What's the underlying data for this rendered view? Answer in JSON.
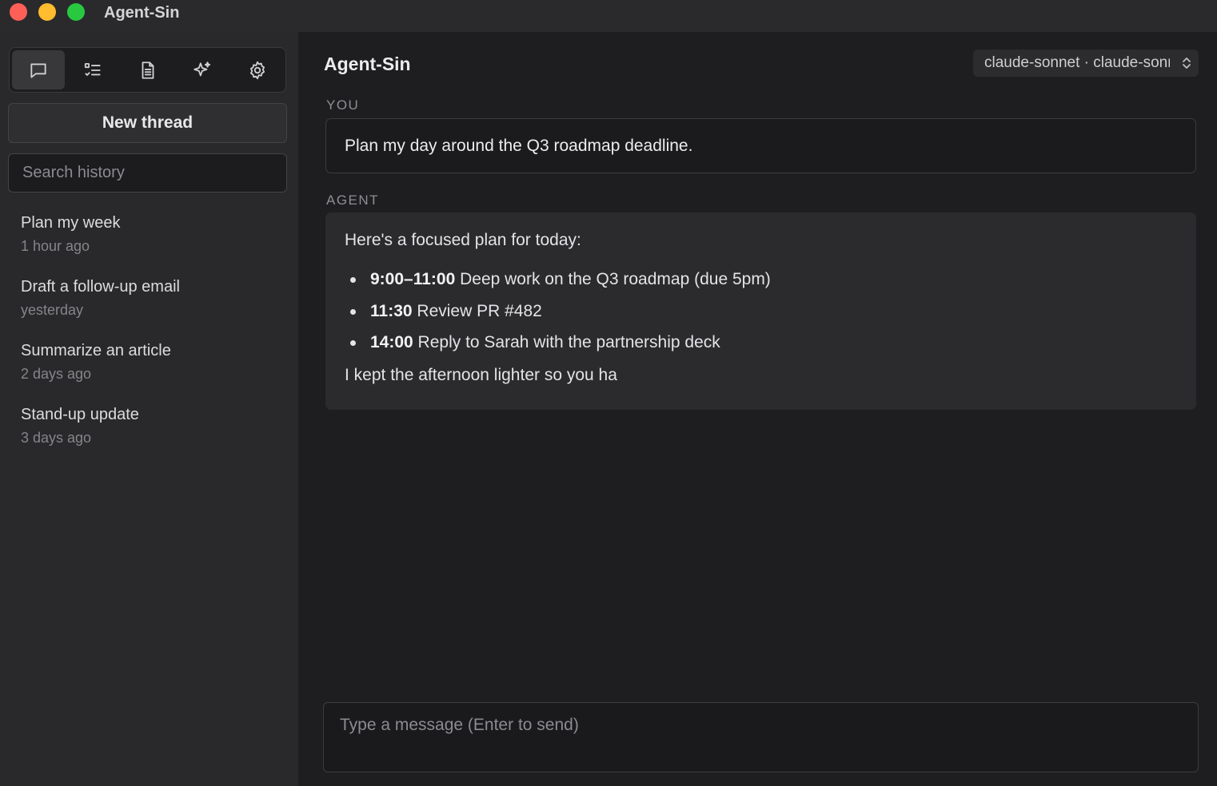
{
  "window": {
    "title": "Agent-Sin"
  },
  "sidebar": {
    "tabs": [
      {
        "name": "chat",
        "icon": "chat-bubble-icon",
        "active": true
      },
      {
        "name": "tasks",
        "icon": "checklist-icon",
        "active": false
      },
      {
        "name": "documents",
        "icon": "document-icon",
        "active": false
      },
      {
        "name": "skills",
        "icon": "sparkles-icon",
        "active": false
      },
      {
        "name": "settings",
        "icon": "gear-icon",
        "active": false
      }
    ],
    "new_thread_label": "New thread",
    "search_placeholder": "Search history",
    "history": [
      {
        "title": "Plan my week",
        "time": "1 hour ago"
      },
      {
        "title": "Draft a follow-up email",
        "time": "yesterday"
      },
      {
        "title": "Summarize an article",
        "time": "2 days ago"
      },
      {
        "title": "Stand-up update",
        "time": "3 days ago"
      }
    ]
  },
  "main": {
    "title": "Agent-Sin",
    "model_select": "claude-sonnet · claude-sonnet",
    "you_label": "YOU",
    "agent_label": "AGENT",
    "user_message": "Plan my day around the Q3 roadmap deadline.",
    "agent_message": {
      "intro": "Here's a focused plan for today:",
      "items": [
        {
          "time": "9:00–11:00",
          "text": " Deep work on the Q3 roadmap (due 5pm)"
        },
        {
          "time": "11:30",
          "text": " Review PR #482"
        },
        {
          "time": "14:00",
          "text": " Reply to Sarah with the partnership deck"
        }
      ],
      "outro": "I kept the afternoon lighter so you ha"
    },
    "composer_placeholder": "Type a message (Enter to send)"
  },
  "colors": {
    "background": "#1e1e20",
    "sidebar": "#29292b",
    "titlebar": "#2a2a2c",
    "agent_bubble": "#2b2b2e",
    "close": "#fe5f57",
    "minimize": "#febc2e",
    "maximize": "#28c840"
  }
}
